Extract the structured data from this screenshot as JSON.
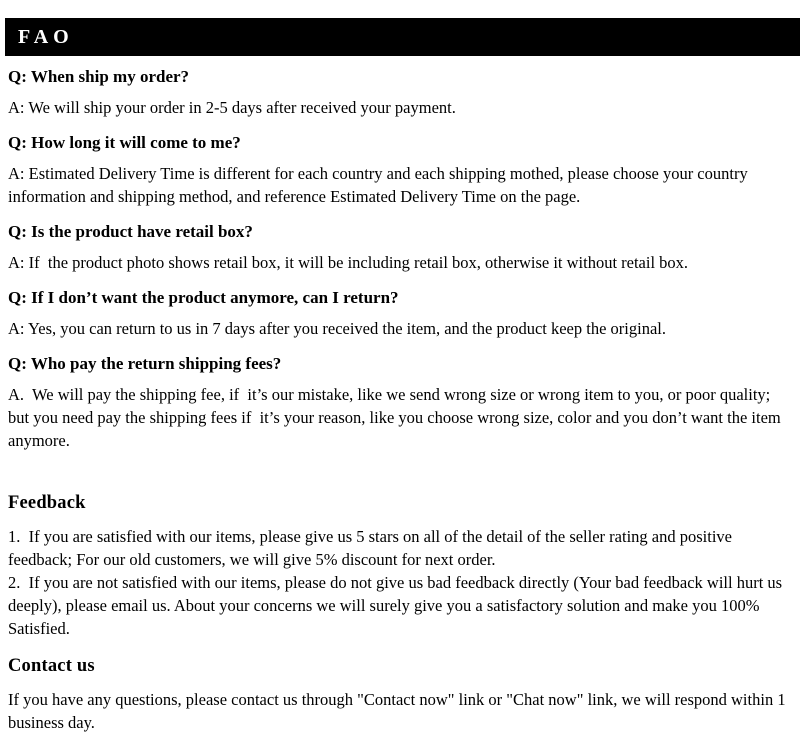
{
  "header": {
    "title": "FAO",
    "background_color": "#000000",
    "text_color": "#ffffff"
  },
  "faq": {
    "items": [
      {
        "question": "Q: When ship my order?",
        "answer": "A: We will ship your order in 2-5 days after received your payment."
      },
      {
        "question": "Q: How long it will come to me?",
        "answer": "A: Estimated Delivery Time is different for each country and each shipping mothed, please choose your country information and shipping method, and reference Estimated Delivery Time on the page."
      },
      {
        "question": "Q: Is the product have retail box?",
        "answer": "A: If  the product photo shows retail box, it will be including retail box, otherwise it without retail box."
      },
      {
        "question": "Q: If I don’t want the product anymore, can I return?",
        "answer": "A: Yes, you can return to us in 7 days after you received the item, and the product keep the original."
      },
      {
        "question": "Q: Who pay the return shipping fees?",
        "answer": "A.  We will pay the shipping fee, if  it’s our mistake, like we send wrong size or wrong item to you, or poor quality; but you need pay the shipping fees if  it’s your reason, like you choose wrong size, color and you don’t want the item anymore."
      }
    ]
  },
  "feedback": {
    "heading": "Feedback",
    "item_1": "1.  If you are satisfied with our items, please give us 5 stars on all of the detail of the seller rating and positive feedback; For our old customers, we will give 5% discount for next order.",
    "item_2": "2.  If you are not satisfied with our items, please do not give us bad feedback directly (Your bad feedback will hurt us deeply), please email us. About your concerns we will surely give you a satisfactory solution and make you 100% Satisfied."
  },
  "contact": {
    "heading": "Contact us",
    "body": "If you have any questions, please contact us through \"Contact now\" link or \"Chat now\" link, we will respond within 1 business day."
  }
}
